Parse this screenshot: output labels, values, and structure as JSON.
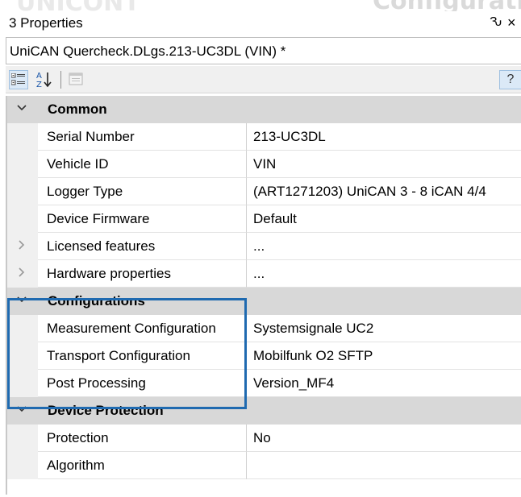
{
  "background": {
    "left_text": "UNICONT",
    "right_text": "Configuration"
  },
  "panel": {
    "title": "3 Properties",
    "pin_glyph": "Ԅ",
    "close_glyph": "×",
    "object_name": "UniCAN Quercheck.DLgs.213-UC3DL (VIN) *"
  },
  "toolbar": {
    "buttons": [
      "categorized-icon",
      "alphabetical-icon",
      "property-pages-icon",
      "help-icon"
    ],
    "help_label": "?"
  },
  "categories": [
    {
      "label": "Common",
      "expanded": true,
      "properties": [
        {
          "name": "Serial Number",
          "value": "213-UC3DL"
        },
        {
          "name": "Vehicle ID",
          "value": "VIN"
        },
        {
          "name": "Logger Type",
          "value": "(ART1271203) UniCAN 3 - 8 iCAN 4/4"
        },
        {
          "name": "Device Firmware",
          "value": "Default"
        },
        {
          "name": "Licensed features",
          "value": "...",
          "expandable": true
        },
        {
          "name": "Hardware properties",
          "value": "...",
          "expandable": true
        }
      ]
    },
    {
      "label": "Configurations",
      "expanded": true,
      "properties": [
        {
          "name": "Measurement Configuration",
          "value": "Systemsignale UC2"
        },
        {
          "name": "Transport Configuration",
          "value": "Mobilfunk O2 SFTP"
        },
        {
          "name": "Post Processing",
          "value": "Version_MF4"
        }
      ]
    },
    {
      "label": "Device Protection",
      "expanded": true,
      "properties": [
        {
          "name": "Protection",
          "value": "No"
        },
        {
          "name": "Algorithm",
          "value": ""
        }
      ]
    }
  ],
  "colors": {
    "highlight": "#1f6ab0",
    "category_bg": "#d8d8d8",
    "gutter": "#f0f0f0"
  }
}
